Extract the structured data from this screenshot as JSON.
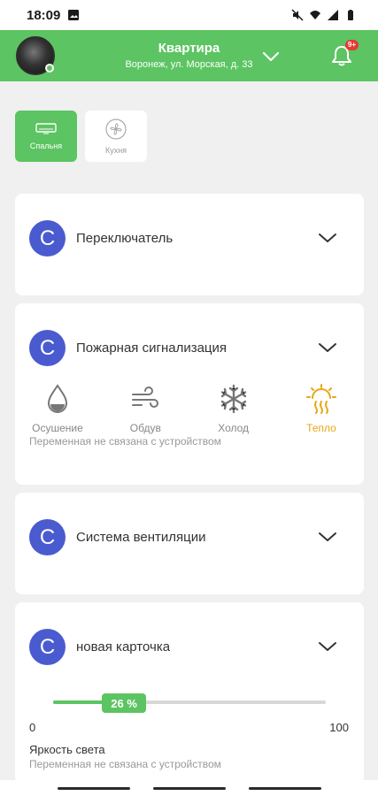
{
  "status_bar": {
    "time": "18:09"
  },
  "header": {
    "title": "Квартира",
    "subtitle": "Воронеж, ул. Морская, д. 33",
    "notification_badge": "9+"
  },
  "rooms": [
    {
      "label": "Спальня",
      "icon": "air-conditioner-icon",
      "active": true
    },
    {
      "label": "Кухня",
      "icon": "fan-icon",
      "active": false
    }
  ],
  "cards": [
    {
      "avatar_letter": "С",
      "title": "Переключатель"
    },
    {
      "avatar_letter": "С",
      "title": "Пожарная сигнализация",
      "modes": [
        {
          "label": "Осушение",
          "icon": "droplet-icon"
        },
        {
          "label": "Обдув",
          "icon": "wind-icon"
        },
        {
          "label": "Холод",
          "icon": "snowflake-icon"
        },
        {
          "label": "Тепло",
          "icon": "sun-heat-icon",
          "selected": true
        }
      ],
      "note": "Переменная не связана с устройством"
    },
    {
      "avatar_letter": "С",
      "title": "Система вентиляции"
    },
    {
      "avatar_letter": "С",
      "title": "новая карточка",
      "slider": {
        "value": 26,
        "value_label": "26 %",
        "min_label": "0",
        "max_label": "100",
        "title": "Яркость света",
        "note": "Переменная не связана с устройством"
      }
    }
  ],
  "colors": {
    "accent": "#5cc462",
    "avatar": "#4a5bd0",
    "mode_selected": "#e6a817",
    "badge": "#e53935"
  }
}
